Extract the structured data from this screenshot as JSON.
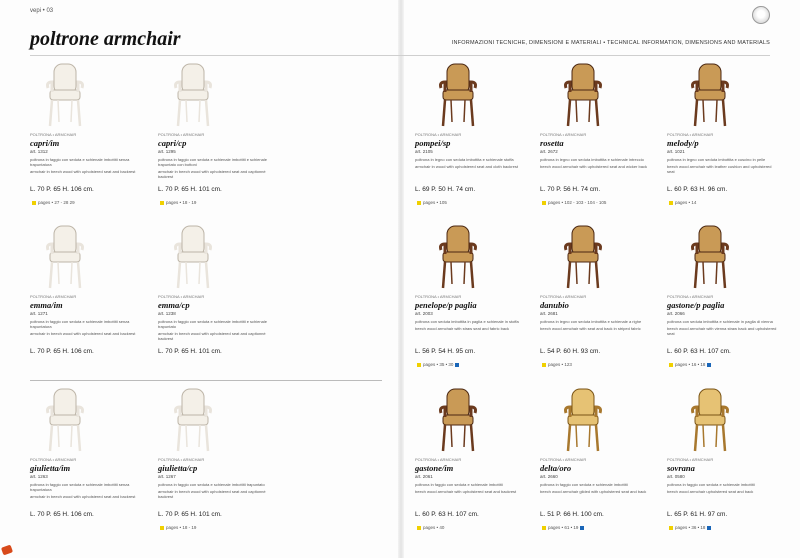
{
  "header": {
    "page_label": "vepi • 03",
    "title": "poltrone armchair",
    "subtitle": "INFORMAZIONI TECNICHE, DIMENSIONI E MATERIALI • TECHNICAL INFORMATION, DIMENSIONS AND MATERIALS"
  },
  "items": [
    {
      "cat": "POLTRONA • ARMCHAIR",
      "name": "capri/im",
      "art": "art. 1312",
      "desc1": "poltrona in faggio con seduta e schienale imbottiti senza trapuntatura",
      "desc2": "armchair in beech wood with upholstered seat and backrest",
      "dims": "L. 70 P. 65 H. 106 cm.",
      "pages": "pages • 27 - 28 29",
      "sq": "y"
    },
    {
      "cat": "POLTRONA • ARMCHAIR",
      "name": "capri/cp",
      "art": "art. 1295",
      "desc1": "poltrona in faggio con seduta e schienale imbottiti e schienale trapuntato con bottoni",
      "desc2": "armchair in beech wood with upholstered seat and capitonné backrest",
      "dims": "L. 70 P. 65 H. 101 cm.",
      "pages": "pages • 18 - 19",
      "sq": "y"
    },
    {
      "cat": "POLTRONA • ARMCHAIR",
      "name": "pompei/sp",
      "art": "art. 2105",
      "desc1": "poltrona in legno con seduta imbottita e schienale stoffa",
      "desc2": "armchair in wood with upholstered seat and cloth backrest",
      "dims": "L. 69 P. 50 H. 74 cm.",
      "pages": "pages • 105",
      "sq": "y"
    },
    {
      "cat": "POLTRONA • ARMCHAIR",
      "name": "rosetta",
      "art": "art. 2672",
      "desc1": "poltrona in legno con seduta imbottita e schienale intreccio",
      "desc2": "beech wood armchair with upholstered seat and wicker back",
      "dims": "L. 70 P. 56 H. 74 cm.",
      "pages": "pages • 102 - 103 - 104 - 105",
      "sq": "y"
    },
    {
      "cat": "POLTRONA • ARMCHAIR",
      "name": "melody/p",
      "art": "art. 1021",
      "desc1": "poltrona in legno con seduta imbottita e cuscino in pelle",
      "desc2": "beech wood armchair with leather cushion and upholstered seat",
      "dims": "L. 60 P. 63 H. 96 cm.",
      "pages": "pages • 14",
      "sq": "y"
    },
    {
      "cat": "POLTRONA • ARMCHAIR",
      "name": "emma/im",
      "art": "art. 1271",
      "desc1": "poltrona in faggio con seduta e schienale imbottiti senza trapuntatura",
      "desc2": "armchair in beech wood with upholstered seat and backrest",
      "dims": "L. 70 P. 65 H. 106 cm.",
      "pages": "",
      "sq": ""
    },
    {
      "cat": "POLTRONA • ARMCHAIR",
      "name": "emma/cp",
      "art": "art. 1238",
      "desc1": "poltrona in faggio con seduta e schienale imbottiti e schienale trapuntato",
      "desc2": "armchair in beech wood with upholstered seat and capitonné backrest",
      "dims": "L. 70 P. 65 H. 101 cm.",
      "pages": "",
      "sq": ""
    },
    {
      "cat": "POLTRONA • ARMCHAIR",
      "name": "penelope/p paglia",
      "art": "art. 2003",
      "desc1": "poltrona con seduta imbottita in paglia e schienale in stoffa",
      "desc2": "beech wood armchair with straw seat and fabric back",
      "dims": "L. 56 P. 54 H. 95 cm.",
      "pages": "pages • 35 • 30",
      "sq": "yb"
    },
    {
      "cat": "POLTRONA • ARMCHAIR",
      "name": "danubio",
      "art": "art. 2681",
      "desc1": "poltrona in legno con seduta imbottita e schienale a righe",
      "desc2": "beech wood armchair with seat and back in striped fabric",
      "dims": "L. 54 P. 60 H. 93 cm.",
      "pages": "pages • 123",
      "sq": "y"
    },
    {
      "cat": "POLTRONA • ARMCHAIR",
      "name": "gastone/p paglia",
      "art": "art. 2066",
      "desc1": "poltrona con seduta imbottita e schienale in paglia di vienna",
      "desc2": "beech wood armchair with vienna straw back and upholstered seat",
      "dims": "L. 60 P. 63 H. 107 cm.",
      "pages": "pages • 16 • 18",
      "sq": "yb"
    },
    {
      "cat": "POLTRONA • ARMCHAIR",
      "name": "giulietta/im",
      "art": "art. 1263",
      "desc1": "poltrona in faggio con seduta e schienale imbottiti senza trapuntatura",
      "desc2": "armchair in beech wood with upholstered seat and backrest",
      "dims": "L. 70 P. 65 H. 106 cm.",
      "pages": "",
      "sq": ""
    },
    {
      "cat": "POLTRONA • ARMCHAIR",
      "name": "giulietta/cp",
      "art": "art. 1267",
      "desc1": "poltrona in faggio con seduta e schienale imbottiti trapuntato",
      "desc2": "armchair in beech wood with upholstered seat and capitonné backrest",
      "dims": "L. 70 P. 65 H. 101 cm.",
      "pages": "pages • 18 - 19",
      "sq": "y"
    },
    {
      "cat": "POLTRONA • ARMCHAIR",
      "name": "gastone/im",
      "art": "art. 2061",
      "desc1": "poltrona in faggio con seduta e schienale imbottiti",
      "desc2": "beech wood armchair with upholstered seat and backrest",
      "dims": "L. 60 P. 63 H. 107 cm.",
      "pages": "pages • 40",
      "sq": "y"
    },
    {
      "cat": "POLTRONA • ARMCHAIR",
      "name": "delta/oro",
      "art": "art. 2660",
      "desc1": "poltrona in faggio con seduta e schienale imbottiti",
      "desc2": "beech wood armchair gilded with upholstered seat and back",
      "dims": "L. 51 P. 66 H. 100 cm.",
      "pages": "pages • 61 • 19",
      "sq": "yb"
    },
    {
      "cat": "POLTRONA • ARMCHAIR",
      "name": "sovrana",
      "art": "art. 0580",
      "desc1": "poltrona in faggio con seduta e schienale imbottiti",
      "desc2": "beech wood armchair upholstered seat and back",
      "dims": "L. 65 P. 61 H. 97 cm.",
      "pages": "pages • 36 • 18",
      "sq": "yb"
    }
  ]
}
